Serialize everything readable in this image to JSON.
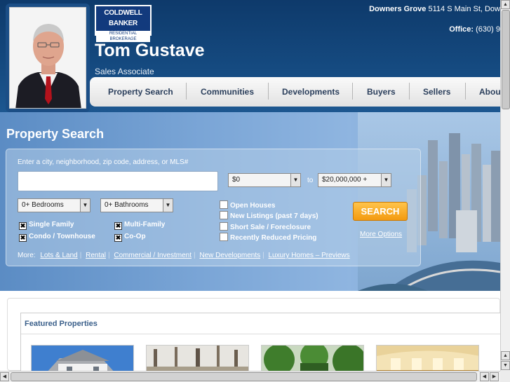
{
  "header": {
    "brand_line1": "COLDWELL",
    "brand_line2": "BANKER",
    "brand_line3": "RESIDENTIAL BROKERAGE",
    "agent_name": "Tom Gustave",
    "agent_title": "Sales Associate",
    "office_city": "Downers Grove",
    "office_address": "5114 S Main St, Dow",
    "office_label": "Office:",
    "office_phone": "(630) 9"
  },
  "nav": {
    "items": [
      {
        "label": "Property Search"
      },
      {
        "label": "Communities"
      },
      {
        "label": "Developments"
      },
      {
        "label": "Buyers"
      },
      {
        "label": "Sellers"
      },
      {
        "label": "Abou"
      }
    ]
  },
  "search": {
    "title": "Property Search",
    "location_hint": "Enter a city, neighborhood, zip code, address, or MLS#",
    "location_value": "",
    "price_min": "$0",
    "price_to": "to",
    "price_max": "$20,000,000 +",
    "bedrooms": "0+ Bedrooms",
    "bathrooms": "0+ Bathrooms",
    "property_types": [
      {
        "label": "Single Family",
        "checked": true
      },
      {
        "label": "Multi-Family",
        "checked": true
      },
      {
        "label": "Condo / Townhouse",
        "checked": true
      },
      {
        "label": "Co-Op",
        "checked": true
      }
    ],
    "filters": [
      {
        "label": "Open Houses",
        "checked": false
      },
      {
        "label": "New Listings (past 7 days)",
        "checked": false
      },
      {
        "label": "Short Sale / Foreclosure",
        "checked": false
      },
      {
        "label": "Recently Reduced Pricing",
        "checked": false
      }
    ],
    "search_button": "SEARCH",
    "more_options": "More Options",
    "more_label": "More:",
    "more_links": [
      "Lots & Land",
      "Rental",
      "Commercial / Investment",
      "New Developments",
      "Luxury Homes – Previews"
    ]
  },
  "featured": {
    "title": "Featured Properties"
  },
  "colors": {
    "header_blue": "#154a80",
    "accent_orange": "#f39a10",
    "link_blue": "#3a5f8a"
  }
}
